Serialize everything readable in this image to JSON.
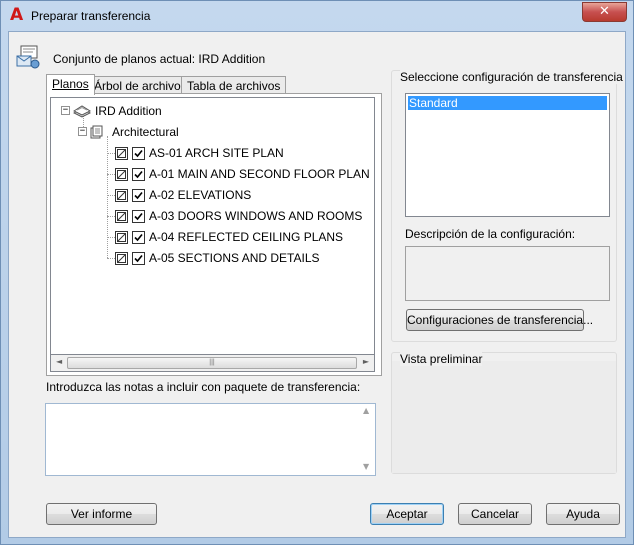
{
  "window": {
    "title": "Preparar transferencia",
    "close_glyph": "✕",
    "app_icon_glyph": "A",
    "accent_color": "#c75050"
  },
  "sheet_set": {
    "label": "Conjunto de planos actual: IRD Addition"
  },
  "tabs": [
    {
      "label": "Planos",
      "active": true
    },
    {
      "label": "Árbol de archivos",
      "active": false
    },
    {
      "label": "Tabla de archivos",
      "active": false
    }
  ],
  "tree": {
    "root": {
      "label": "IRD Addition",
      "expander": "−",
      "icon": "sheet-set-icon"
    },
    "subset": {
      "label": "Architectural",
      "expander": "−",
      "icon": "subset-icon"
    },
    "sheets": [
      {
        "label": "AS-01 ARCH SITE PLAN",
        "checked": true
      },
      {
        "label": "A-01 MAIN AND SECOND FLOOR PLAN",
        "checked": true
      },
      {
        "label": "A-02 ELEVATIONS",
        "checked": true
      },
      {
        "label": "A-03 DOORS WINDOWS AND ROOMS",
        "checked": true
      },
      {
        "label": "A-04 REFLECTED CEILING PLANS",
        "checked": true
      },
      {
        "label": "A-05 SECTIONS AND DETAILS",
        "checked": true
      }
    ],
    "hscroll": {
      "left_arrow": "◄",
      "right_arrow": "►",
      "thumb_grip": "|||"
    }
  },
  "notes": {
    "label": "Introduzca las notas a incluir con paquete de transferencia:",
    "value": "",
    "scroll_up": "▲",
    "scroll_down": "▼"
  },
  "transfer_config": {
    "title": "Seleccione configuración de transferencia",
    "items": [
      "Standard"
    ],
    "selected": "Standard",
    "selection_color": "#3399ff",
    "description_label": "Descripción de la configuración:",
    "description_value": "",
    "configs_button": "Configuraciones de transferencia..."
  },
  "preview": {
    "title": "Vista preliminar"
  },
  "buttons": {
    "report": "Ver informe",
    "accept": "Aceptar",
    "cancel": "Cancelar",
    "help": "Ayuda"
  }
}
